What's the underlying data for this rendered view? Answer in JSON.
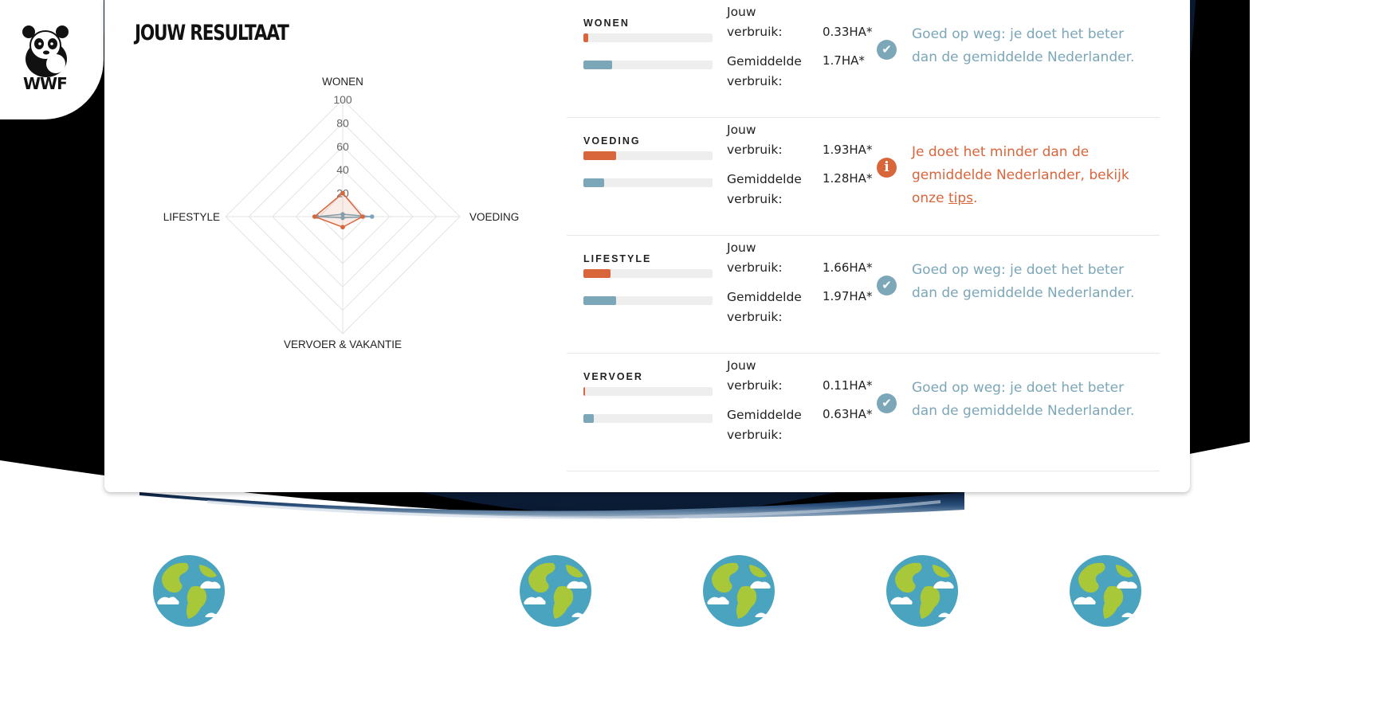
{
  "brand": {
    "logo_text": "WWF"
  },
  "title": "JOUW RESULTAAT",
  "colors": {
    "you": "#d9653b",
    "average": "#7ba7b8",
    "space": "#000000",
    "card": "#ffffff"
  },
  "chart_data": {
    "type": "radar",
    "axes": [
      "WONEN",
      "VOEDING",
      "VERVOER & VAKANTIE",
      "LIFESTYLE"
    ],
    "ticks": [
      "20",
      "40",
      "60",
      "80",
      "100"
    ],
    "range": [
      0,
      100
    ],
    "series": [
      {
        "values": [
          2,
          25,
          1,
          22
        ]
      },
      {
        "values": [
          20,
          17,
          9,
          24
        ]
      }
    ]
  },
  "rows": [
    {
      "name": "WONEN",
      "you_label": "Jouw verbruik:",
      "you_value": "0.33HA*",
      "avg_label": "Gemiddelde verbruik:",
      "avg_value": "1.7HA*",
      "you_fraction": 0.04,
      "avg_fraction": 0.22,
      "status": "good",
      "icon": "check-icon",
      "message": "Goed op weg: je doet het beter dan de gemiddelde Nederlander."
    },
    {
      "name": "VOEDING",
      "you_label": "Jouw verbruik:",
      "you_value": "1.93HA*",
      "avg_label": "Gemiddelde verbruik:",
      "avg_value": "1.28HA*",
      "you_fraction": 0.25,
      "avg_fraction": 0.16,
      "status": "warn",
      "icon": "info-icon",
      "message_pre": "Je doet het minder dan de gemiddelde Nederlander, bekijk onze ",
      "message_link": "tips",
      "message_post": "."
    },
    {
      "name": "LIFESTYLE",
      "you_label": "Jouw verbruik:",
      "you_value": "1.66HA*",
      "avg_label": "Gemiddelde verbruik:",
      "avg_value": "1.97HA*",
      "you_fraction": 0.21,
      "avg_fraction": 0.25,
      "status": "good",
      "icon": "check-icon",
      "message": "Goed op weg: je doet het beter dan de gemiddelde Nederlander."
    },
    {
      "name": "VERVOER",
      "you_label": "Jouw verbruik:",
      "you_value": "0.11HA*",
      "avg_label": "Gemiddelde verbruik:",
      "avg_value": "0.63HA*",
      "you_fraction": 0.01,
      "avg_fraction": 0.08,
      "status": "good",
      "icon": "check-icon",
      "message": "Goed op weg: je doet het beter dan de gemiddelde Nederlander."
    }
  ],
  "globes": [
    "globe-icon",
    "globe-icon",
    "globe-icon",
    "globe-icon",
    "globe-icon"
  ]
}
